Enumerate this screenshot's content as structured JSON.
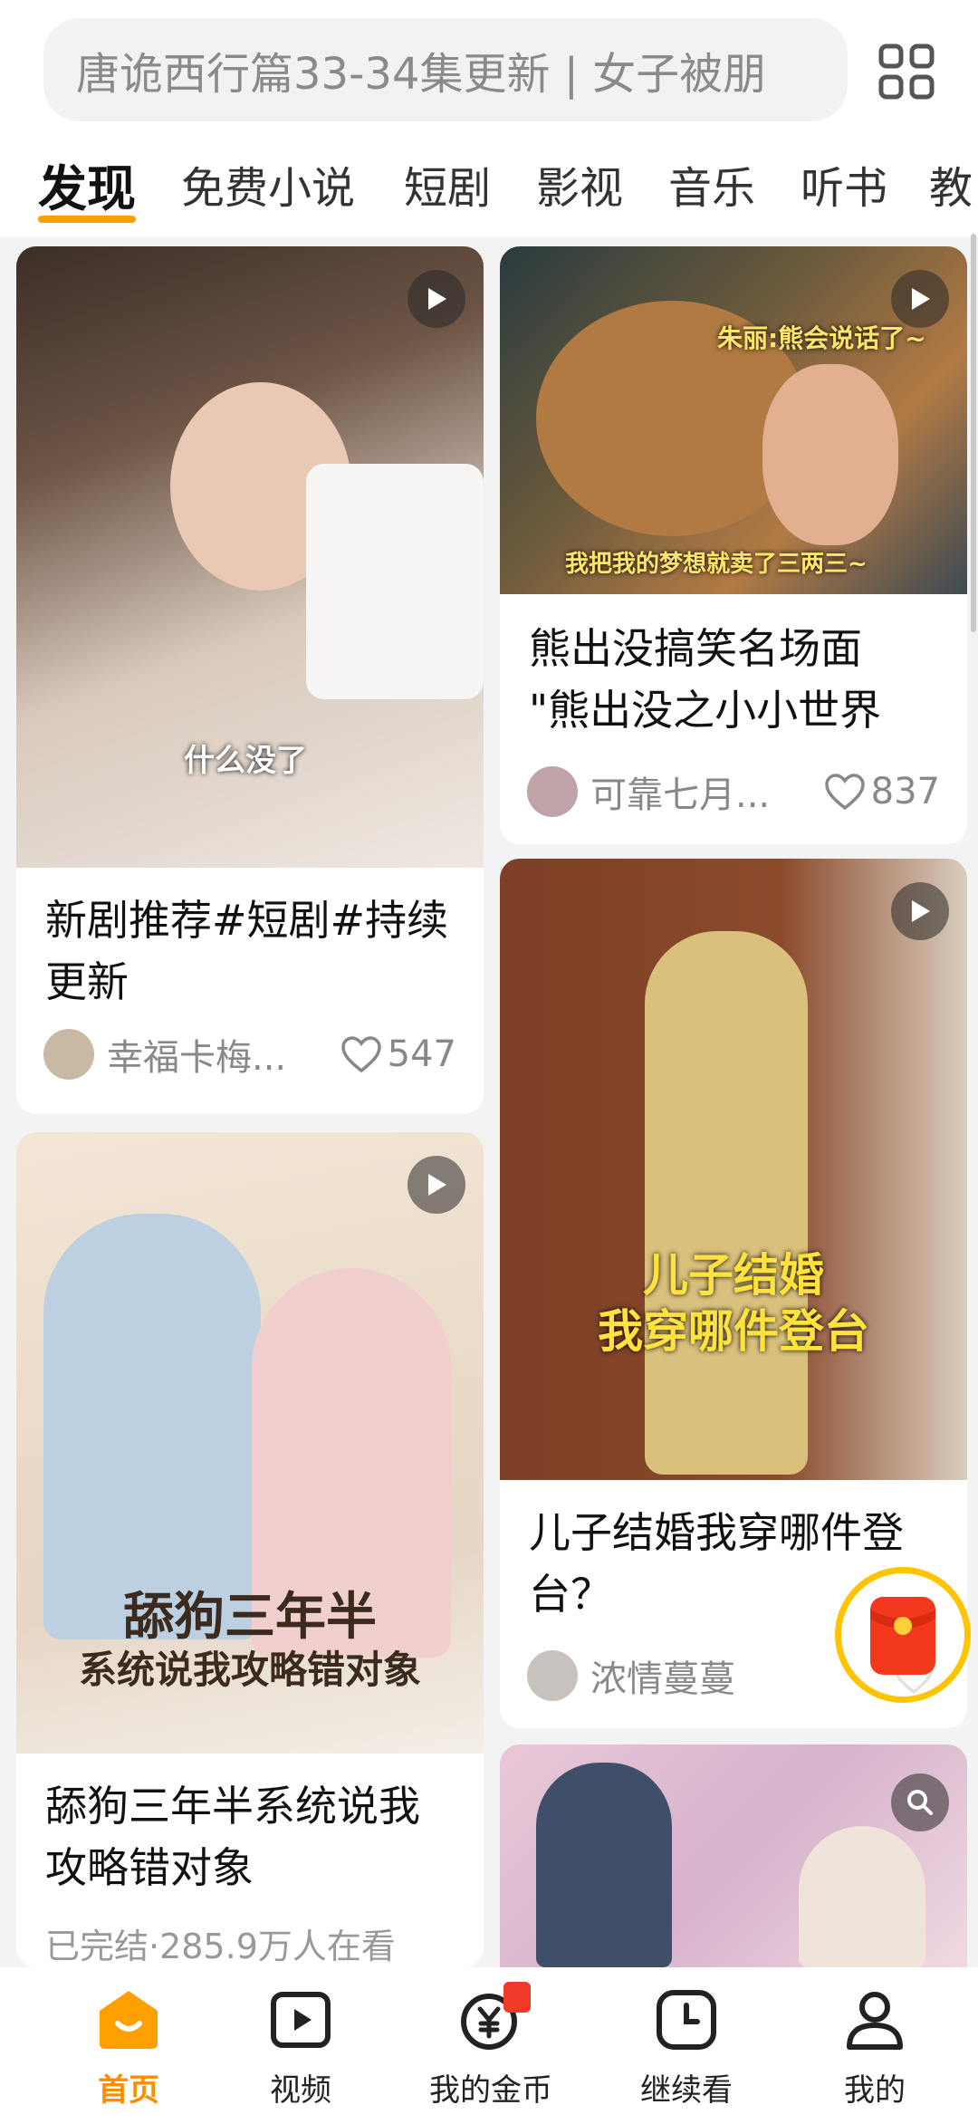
{
  "search": {
    "placeholder": "唐诡西行篇33-34集更新 | 女子被朋"
  },
  "tabs": [
    "发现",
    "免费小说",
    "短剧",
    "影视",
    "音乐",
    "听书",
    "教"
  ],
  "cards": [
    {
      "title_line1": "新剧推荐#短剧#持续",
      "title_line2": "更新",
      "author": "幸福卡梅...",
      "likes": "547",
      "overlay": "什么没了"
    },
    {
      "title_line1": "熊出没搞笑名场面",
      "title_line2": "\"熊出没之小小世界",
      "author": "可靠七月...",
      "likes": "837",
      "overlay_top": "朱丽:熊会说话了~",
      "overlay_bottom": "我把我的梦想就卖了三两三~"
    },
    {
      "title_line1": "舔狗三年半系统说我",
      "title_line2": "攻略错对象",
      "status": "已完结·285.9万人在看",
      "poster_line1": "舔狗三年半",
      "poster_line2": "系统说我攻略错对象"
    },
    {
      "title_line1": "儿子结婚我穿哪件登",
      "title_line2": "台？",
      "author": "浓情蔓蔓",
      "overlay_line1": "儿子结婚",
      "overlay_line2": "我穿哪件登台"
    }
  ],
  "nav": [
    {
      "label": "首页",
      "icon": "home-icon",
      "active": true
    },
    {
      "label": "视频",
      "icon": "video-icon"
    },
    {
      "label": "我的金币",
      "icon": "coin-icon"
    },
    {
      "label": "继续看",
      "icon": "clock-icon"
    },
    {
      "label": "我的",
      "icon": "profile-icon"
    }
  ],
  "colors": {
    "accent": "#ffa000",
    "nav_active": "#ff8c00"
  }
}
